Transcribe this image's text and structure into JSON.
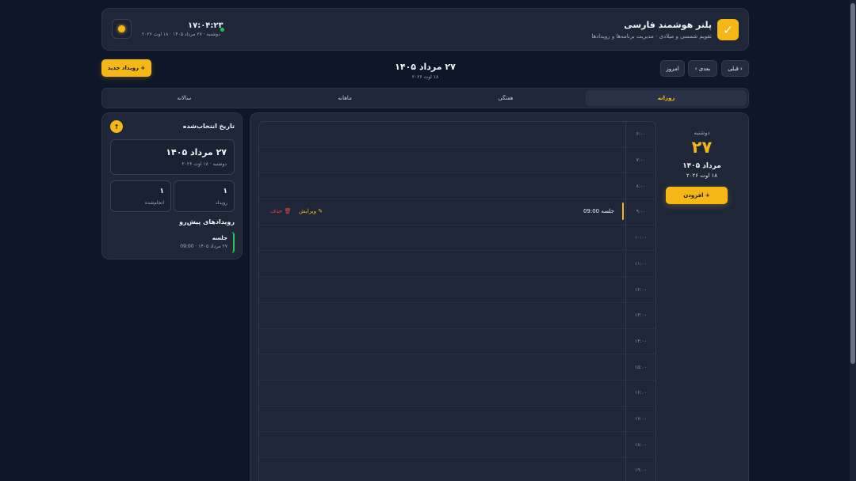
{
  "header": {
    "title": "پلنر هوشمند فارسی",
    "subtitle": "تقویم شمسی و میلادی · مدیریت برنامه‌ها و رویدادها",
    "clock_time": "۱۷:۰۴:۲۳",
    "clock_date": "دوشنبه · ۲۷ مرداد ۱۴۰۵ · ۱۸ اوت ۲۰۲۶",
    "logo_glyph": "✓"
  },
  "nav": {
    "prev_label": "‹ قبلی",
    "next_label": "بعدی ›",
    "today_label": "امروز",
    "current_date": "۲۷ مرداد ۱۴۰۵",
    "current_greg": "۱۸ اوت ۲۰۲۶",
    "new_event_label": "+ رویداد جدید"
  },
  "tabs": [
    {
      "label": "روزانه",
      "active": true
    },
    {
      "label": "هفتگی",
      "active": false
    },
    {
      "label": "ماهانه",
      "active": false
    },
    {
      "label": "سالانه",
      "active": false
    }
  ],
  "side": {
    "title": "تاریخ انتخاب‌شده",
    "up_glyph": "↑",
    "selected_date": "۲۷ مرداد ۱۴۰۵",
    "selected_sub": "دوشنبه · ۱۸ اوت ۲۰۲۶",
    "stats": [
      {
        "value": "۱",
        "label": "رویداد"
      },
      {
        "value": "۱",
        "label": "انجام‌شده"
      }
    ],
    "upcoming_title": "رویدادهای پیش‌رو",
    "upcoming": [
      {
        "name": "جلسه",
        "time": "۲۷ مرداد ۱۴۰۵ · 09:00"
      }
    ]
  },
  "day": {
    "weekday": "دوشنبه",
    "day_number": "۲۷",
    "month_year": "مرداد ۱۴۰۵",
    "gregorian": "۱۸ اوت ۲۰۲۶",
    "add_label": "+ افزودن"
  },
  "hours": [
    "۶:۰۰",
    "۷:۰۰",
    "۸:۰۰",
    "۹:۰۰",
    "۱۰:۰۰",
    "۱۱:۰۰",
    "۱۲:۰۰",
    "۱۳:۰۰",
    "۱۴:۰۰",
    "۱۵:۰۰",
    "۱۶:۰۰",
    "۱۷:۰۰",
    "۱۸:۰۰",
    "۱۹:۰۰"
  ],
  "event": {
    "title": "جلسه 09:00",
    "edit_label": "✎ ویرایش",
    "delete_label": "🗑 حذف",
    "row_index": 3
  },
  "colors": {
    "accent": "#f5b716",
    "background": "#0f1628",
    "panel": "#1e2638",
    "success": "#22c55e",
    "danger": "#ef4444"
  }
}
